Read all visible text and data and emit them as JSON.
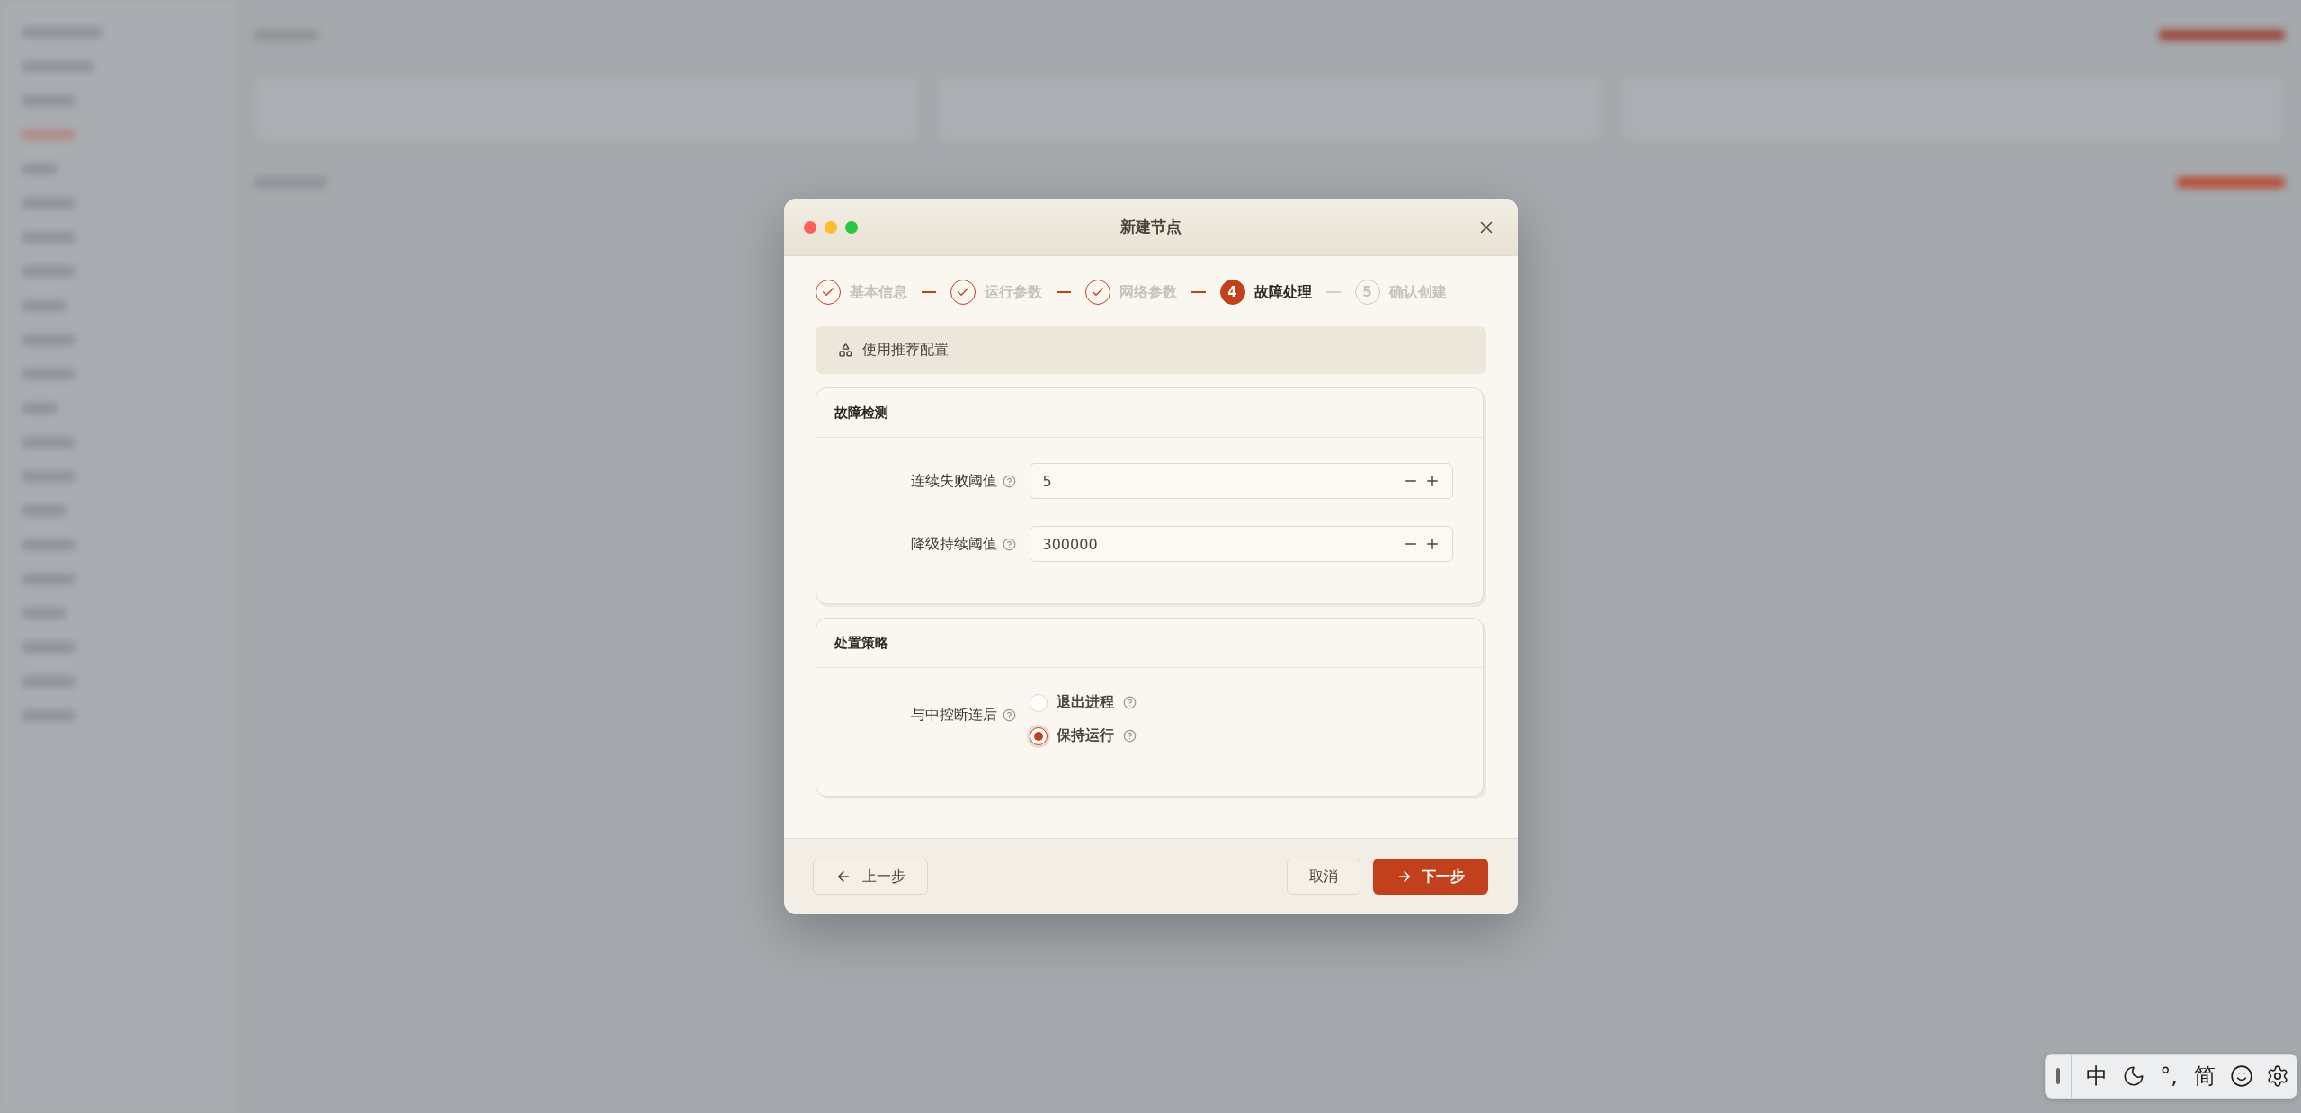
{
  "window": {
    "title": "新建节点"
  },
  "steps": [
    {
      "label": "基本信息",
      "completed": true,
      "selected": false
    },
    {
      "label": "运行参数",
      "completed": true,
      "selected": false
    },
    {
      "label": "网络参数",
      "completed": true,
      "selected": false
    },
    {
      "label": "故障处理",
      "completed": false,
      "selected": true,
      "number": "4"
    },
    {
      "label": "确认创建",
      "completed": false,
      "selected": false,
      "number": "5"
    }
  ],
  "recommend_button": "使用推荐配置",
  "sections": [
    {
      "title": "故障检测",
      "fields": [
        {
          "kind": "number",
          "label": "连续失败阈值",
          "value": "5"
        },
        {
          "kind": "number",
          "label": "降级持续阈值",
          "value": "300000"
        }
      ]
    },
    {
      "title": "处置策略",
      "fields": [
        {
          "kind": "radio",
          "label": "与中控断连后",
          "options": [
            {
              "label": "退出进程",
              "selected": false
            },
            {
              "label": "保持运行",
              "selected": true
            }
          ]
        }
      ]
    }
  ],
  "footer": {
    "back": "上一步",
    "cancel": "取消",
    "next": "下一步"
  },
  "ime_bar": {
    "items": [
      {
        "kind": "text",
        "text": "中"
      },
      {
        "kind": "moon"
      },
      {
        "kind": "text",
        "text": "°,"
      },
      {
        "kind": "text",
        "text": "简"
      },
      {
        "kind": "smiley"
      },
      {
        "kind": "gear"
      }
    ]
  }
}
